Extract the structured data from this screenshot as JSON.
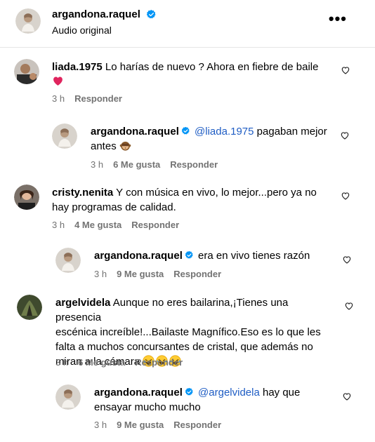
{
  "header": {
    "username": "argandona.raquel",
    "subtitle": "Audio original",
    "more_icon": "more-horizontal-icon"
  },
  "colors": {
    "mention": "#1f5dc4",
    "verified": "#0095f6",
    "meta": "#737373",
    "heart_red": "#e0245e"
  },
  "labels": {
    "reply": "Responder"
  },
  "comments": [
    {
      "username": "liada.1975",
      "text": "Lo harías de nuevo ? Ahora en fiebre de baile",
      "time": "3 h",
      "likes": "",
      "reply": "Responder"
    },
    {
      "username": "argandona.raquel",
      "mention": "@liada.1975",
      "text": "pagaban mejor",
      "text2": "antes",
      "time": "3 h",
      "likes": "6 Me gusta",
      "reply": "Responder"
    },
    {
      "username": "cristy.nenita",
      "text": "Y con música en vivo, lo mejor...pero ya no",
      "text2": "hay programas de calidad.",
      "time": "3 h",
      "likes": "4 Me gusta",
      "reply": "Responder"
    },
    {
      "username": "argandona.raquel",
      "text": "era en vivo tienes razón",
      "time": "3 h",
      "likes": "9 Me gusta",
      "reply": "Responder"
    },
    {
      "username": "argelvidela",
      "text": "Aunque no eres bailarina,¡Tienes una presencia",
      "text2": "escénica increíble!...Bailaste Magnífico.Eso es lo que les",
      "text3": "falta a muchos concursantes de cristal, que además no",
      "text4": "miran a la cámara",
      "time": "3 h",
      "likes": "6 Me gusta",
      "reply": "Responder"
    },
    {
      "username": "argandona.raquel",
      "mention": "@argelvidela",
      "text": "hay que",
      "text2": "ensayar mucho mucho",
      "time": "3 h",
      "likes": "9 Me gusta",
      "reply": "Responder"
    }
  ]
}
